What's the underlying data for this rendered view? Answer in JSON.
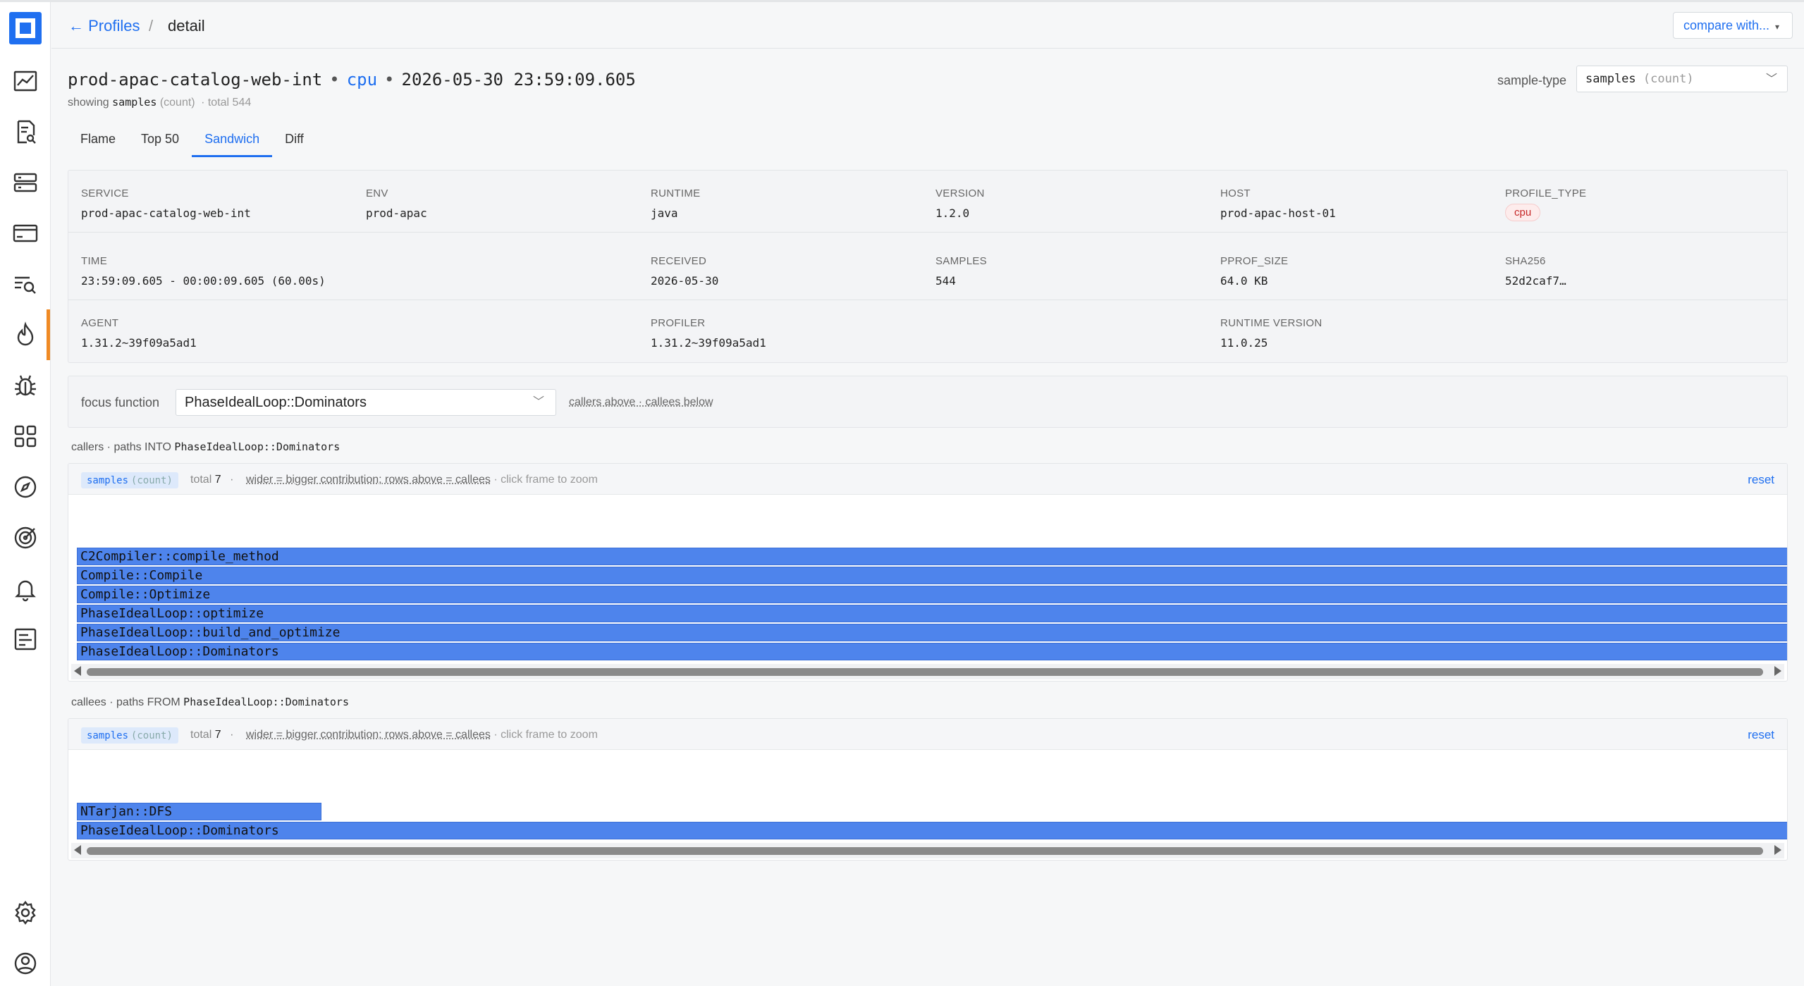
{
  "breadcrumb": {
    "back": "← Profiles",
    "separator": "/",
    "current": "detail"
  },
  "compare": {
    "label": "compare with...",
    "caret": "▾"
  },
  "header": {
    "service": "prod-apac-catalog-web-int",
    "dot": "•",
    "profile_type": "cpu",
    "timestamp": "2026-05-30 23:59:09.605",
    "showing_label": "showing",
    "showing_type": "samples",
    "showing_unit": "(count)",
    "showing_total": "· total 544"
  },
  "sample_type": {
    "label": "sample-type",
    "value": "samples",
    "unit": "(count)"
  },
  "tabs": [
    {
      "label": "Flame"
    },
    {
      "label": "Top 50"
    },
    {
      "label": "Sandwich"
    },
    {
      "label": "Diff"
    }
  ],
  "active_tab": "Sandwich",
  "meta": {
    "service": {
      "k": "SERVICE",
      "v": "prod-apac-catalog-web-int"
    },
    "env": {
      "k": "ENV",
      "v": "prod-apac"
    },
    "runtime": {
      "k": "RUNTIME",
      "v": "java"
    },
    "version": {
      "k": "VERSION",
      "v": "1.2.0"
    },
    "host": {
      "k": "HOST",
      "v": "prod-apac-host-01"
    },
    "profile_type": {
      "k": "PROFILE_TYPE",
      "v": "cpu"
    },
    "time": {
      "k": "TIME",
      "v": "23:59:09.605 - 00:00:09.605 (60.00s)"
    },
    "received": {
      "k": "RECEIVED",
      "v": "2026-05-30"
    },
    "samples": {
      "k": "SAMPLES",
      "v": "544"
    },
    "pprof_size": {
      "k": "PPROF_SIZE",
      "v": "64.0 KB"
    },
    "sha256": {
      "k": "SHA256",
      "v": "52d2caf7…"
    },
    "agent": {
      "k": "AGENT",
      "v": "1.31.2~39f09a5ad1"
    },
    "profiler": {
      "k": "PROFILER",
      "v": "1.31.2~39f09a5ad1"
    },
    "runtime_version": {
      "k": "RUNTIME VERSION",
      "v": "11.0.25"
    }
  },
  "focus": {
    "label": "focus function",
    "value": "PhaseIdealLoop::Dominators",
    "hint": "callers above · callees below"
  },
  "callers": {
    "title_prefix": "callers · paths INTO",
    "title_fn": "PhaseIdealLoop::Dominators",
    "chip_type": "samples",
    "chip_unit": "(count)",
    "total_label": "total",
    "total_value": "7",
    "dot": "·",
    "hint_u": "wider = bigger contribution; rows above = callees",
    "hint_click": "· click frame to zoom",
    "reset": "reset",
    "frames": [
      {
        "name": "C2Compiler::compile_method",
        "fraction": 1.0
      },
      {
        "name": "Compile::Compile",
        "fraction": 1.0
      },
      {
        "name": "Compile::Optimize",
        "fraction": 1.0
      },
      {
        "name": "PhaseIdealLoop::optimize",
        "fraction": 1.0
      },
      {
        "name": "PhaseIdealLoop::build_and_optimize",
        "fraction": 1.0
      },
      {
        "name": "PhaseIdealLoop::Dominators",
        "fraction": 1.0
      }
    ]
  },
  "callees": {
    "title_prefix": "callees · paths FROM",
    "title_fn": "PhaseIdealLoop::Dominators",
    "chip_type": "samples",
    "chip_unit": "(count)",
    "total_label": "total",
    "total_value": "7",
    "dot": "·",
    "hint_u": "wider = bigger contribution; rows above = callees",
    "hint_click": "· click frame to zoom",
    "reset": "reset",
    "frames": [
      {
        "name": "NTarjan::DFS",
        "fraction": 0.143
      },
      {
        "name": "PhaseIdealLoop::Dominators",
        "fraction": 1.0
      }
    ]
  },
  "colors": {
    "accent": "#1f6ff0",
    "frame": "#4e84ec",
    "active_nav": "#f08a24",
    "cpu_badge": "#c62828"
  }
}
